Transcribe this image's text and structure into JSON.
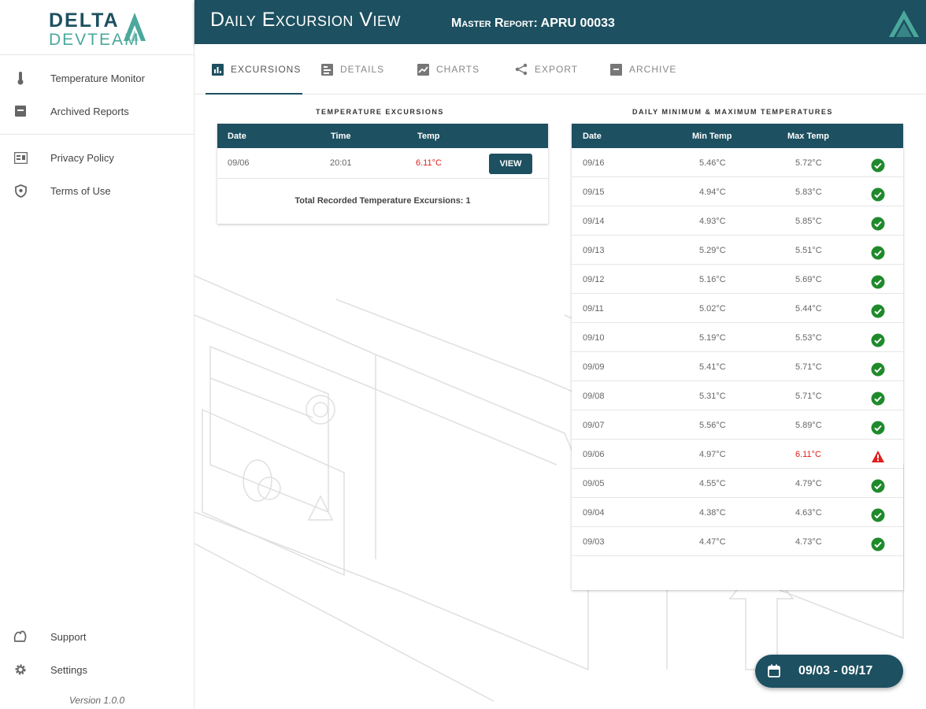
{
  "brand": {
    "line1": "DELTA",
    "line2": "DEVTEAM"
  },
  "sidebar": {
    "primary": [
      {
        "label": "Temperature Monitor",
        "icon": "thermometer-icon"
      },
      {
        "label": "Archived Reports",
        "icon": "archive-icon"
      }
    ],
    "secondary": [
      {
        "label": "Privacy Policy",
        "icon": "policy-icon"
      },
      {
        "label": "Terms of Use",
        "icon": "shield-icon"
      }
    ],
    "bottom": [
      {
        "label": "Support",
        "icon": "support-hand-icon"
      },
      {
        "label": "Settings",
        "icon": "gear-icon"
      }
    ],
    "version": "Version 1.0.0"
  },
  "header": {
    "title": "Daily Excursion View",
    "subtitle": "Master Report: APRU 00033"
  },
  "tabs": [
    {
      "label": "EXCURSIONS",
      "icon": "bar-chart-icon",
      "active": true
    },
    {
      "label": "DETAILS",
      "icon": "details-icon",
      "active": false
    },
    {
      "label": "CHARTS",
      "icon": "line-chart-icon",
      "active": false
    },
    {
      "label": "EXPORT",
      "icon": "share-icon",
      "active": false
    },
    {
      "label": "ARCHIVE",
      "icon": "archive-icon",
      "active": false
    }
  ],
  "excursions": {
    "title": "Temperature Excursions",
    "columns": [
      "Date",
      "Time",
      "Temp"
    ],
    "rows": [
      {
        "date": "09/06",
        "time": "20:01",
        "temp": "6.11°C",
        "button": "VIEW"
      }
    ],
    "total": "Total Recorded Temperature Excursions: 1"
  },
  "daily": {
    "title": "Daily Minimum & Maximum Temperatures",
    "columns": [
      "Date",
      "Min Temp",
      "Max Temp"
    ],
    "rows": [
      {
        "date": "09/16",
        "min": "5.46°C",
        "max": "5.72°C",
        "status": "ok"
      },
      {
        "date": "09/15",
        "min": "4.94°C",
        "max": "5.83°C",
        "status": "ok"
      },
      {
        "date": "09/14",
        "min": "4.93°C",
        "max": "5.85°C",
        "status": "ok"
      },
      {
        "date": "09/13",
        "min": "5.29°C",
        "max": "5.51°C",
        "status": "ok"
      },
      {
        "date": "09/12",
        "min": "5.16°C",
        "max": "5.69°C",
        "status": "ok"
      },
      {
        "date": "09/11",
        "min": "5.02°C",
        "max": "5.44°C",
        "status": "ok"
      },
      {
        "date": "09/10",
        "min": "5.19°C",
        "max": "5.53°C",
        "status": "ok"
      },
      {
        "date": "09/09",
        "min": "5.41°C",
        "max": "5.71°C",
        "status": "ok"
      },
      {
        "date": "09/08",
        "min": "5.31°C",
        "max": "5.71°C",
        "status": "ok"
      },
      {
        "date": "09/07",
        "min": "5.56°C",
        "max": "5.89°C",
        "status": "ok"
      },
      {
        "date": "09/06",
        "min": "4.97°C",
        "max": "6.11°C",
        "status": "warning"
      },
      {
        "date": "09/05",
        "min": "4.55°C",
        "max": "4.79°C",
        "status": "ok"
      },
      {
        "date": "09/04",
        "min": "4.38°C",
        "max": "4.63°C",
        "status": "ok"
      },
      {
        "date": "09/03",
        "min": "4.47°C",
        "max": "4.73°C",
        "status": "ok"
      }
    ]
  },
  "date_range": {
    "label": "09/03 - 09/17",
    "icon": "calendar-icon"
  },
  "colors": {
    "primary": "#1d5060",
    "accent": "#4aa89c",
    "ok": "#1f8a2c",
    "alert": "#e02020"
  }
}
